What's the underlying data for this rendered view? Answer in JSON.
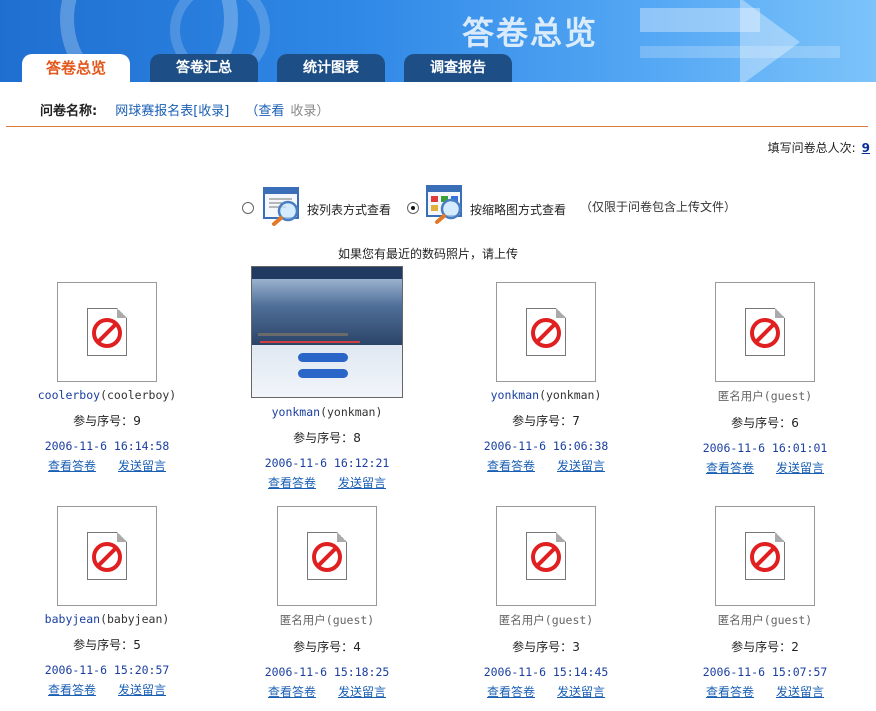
{
  "banner": {
    "title": "答卷总览"
  },
  "tabs": [
    {
      "label": "答卷总览",
      "active": true
    },
    {
      "label": "答卷汇总",
      "active": false
    },
    {
      "label": "统计图表",
      "active": false
    },
    {
      "label": "调查报告",
      "active": false
    }
  ],
  "questionnaire": {
    "label": "问卷名称:",
    "name": "网球赛报名表[收录]",
    "view_link": "（查看",
    "collect_text": "收录）"
  },
  "total": {
    "label": "填写问卷总人次:",
    "value": "9"
  },
  "view_options": {
    "list_label": "按列表方式查看",
    "thumb_label": "按缩略图方式查看",
    "thumb_note": "（仅限于问卷包含上传文件）",
    "selected": "thumb"
  },
  "upload_note": "如果您有最近的数码照片，请上传",
  "entries": [
    {
      "user": "coolerboy",
      "id": "(coolerboy)",
      "seq_label": "参与序号：",
      "seq": "9",
      "time": "2006-11-6  16:14:58",
      "view": "查看答卷",
      "msg": "发送留言",
      "anon": false,
      "photo": false
    },
    {
      "user": "yonkman",
      "id": "(yonkman)",
      "seq_label": "参与序号：",
      "seq": "8",
      "time": "2006-11-6  16:12:21",
      "view": "查看答卷",
      "msg": "发送留言",
      "anon": false,
      "photo": true
    },
    {
      "user": "yonkman",
      "id": "(yonkman)",
      "seq_label": "参与序号：",
      "seq": "7",
      "time": "2006-11-6  16:06:38",
      "view": "查看答卷",
      "msg": "发送留言",
      "anon": false,
      "photo": false
    },
    {
      "user": "匿名用户",
      "id": "(guest)",
      "seq_label": "参与序号：",
      "seq": "6",
      "time": "2006-11-6  16:01:01",
      "view": "查看答卷",
      "msg": "发送留言",
      "anon": true,
      "photo": false
    },
    {
      "user": "babyjean",
      "id": "(babyjean)",
      "seq_label": "参与序号：",
      "seq": "5",
      "time": "2006-11-6  15:20:57",
      "view": "查看答卷",
      "msg": "发送留言",
      "anon": false,
      "photo": false
    },
    {
      "user": "匿名用户",
      "id": "(guest)",
      "seq_label": "参与序号：",
      "seq": "4",
      "time": "2006-11-6  15:18:25",
      "view": "查看答卷",
      "msg": "发送留言",
      "anon": true,
      "photo": false
    },
    {
      "user": "匿名用户",
      "id": "(guest)",
      "seq_label": "参与序号：",
      "seq": "3",
      "time": "2006-11-6  15:14:45",
      "view": "查看答卷",
      "msg": "发送留言",
      "anon": true,
      "photo": false
    },
    {
      "user": "匿名用户",
      "id": "(guest)",
      "seq_label": "参与序号：",
      "seq": "2",
      "time": "2006-11-6  15:07:57",
      "view": "查看答卷",
      "msg": "发送留言",
      "anon": true,
      "photo": false
    }
  ],
  "colors": {
    "banner": "#2f88e6",
    "tab_dark": "#1d4f86",
    "tab_active_text": "#e2561a",
    "divider": "#e07a3a",
    "link": "#1a5fb4"
  }
}
